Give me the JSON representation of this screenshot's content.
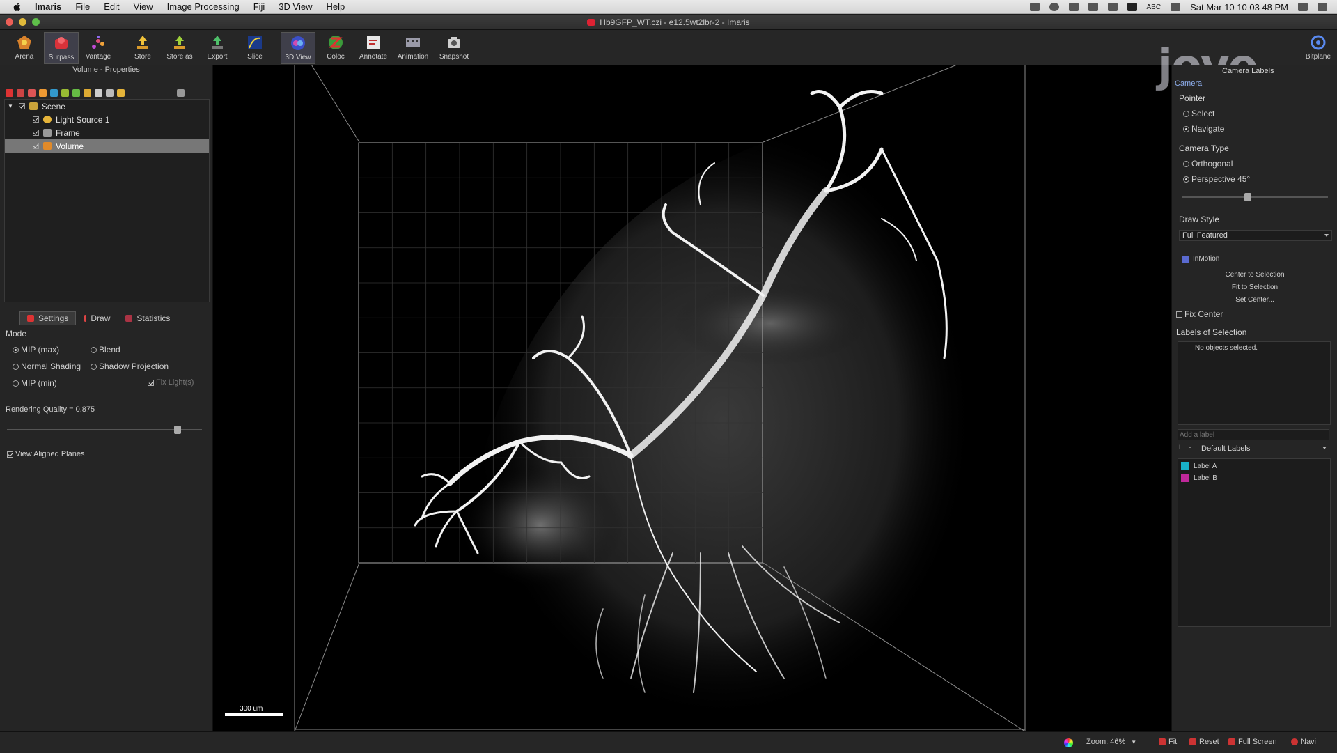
{
  "menubar": {
    "items": [
      "Imaris",
      "File",
      "Edit",
      "View",
      "Image Processing",
      "Fiji",
      "3D View",
      "Help"
    ],
    "input_indicator": "ABC",
    "clock": "Sat Mar 10  10 03 48 PM"
  },
  "window": {
    "title": "Hb9GFP_WT.czi - e12.5wt2lbr-2 - Imaris"
  },
  "toolbar": {
    "buttons": [
      "Arena",
      "Surpass",
      "Vantage",
      "Store",
      "Store as",
      "Export",
      "Slice",
      "3D View",
      "Coloc",
      "Annotate",
      "Animation",
      "Snapshot"
    ],
    "right_button": "Bitplane",
    "active": [
      "Surpass",
      "3D View"
    ]
  },
  "left_panel": {
    "title": "Volume - Properties",
    "tree": [
      {
        "label": "Scene",
        "checked": true,
        "selected": false
      },
      {
        "label": "Light Source 1",
        "checked": true,
        "selected": false
      },
      {
        "label": "Frame",
        "checked": true,
        "selected": false
      },
      {
        "label": "Volume",
        "checked": true,
        "selected": true
      }
    ],
    "tabs": [
      "Settings",
      "Draw",
      "Statistics"
    ],
    "mode_label": "Mode",
    "modes": [
      "MIP (max)",
      "Blend",
      "Normal Shading",
      "Shadow Projection",
      "MIP (min)"
    ],
    "selected_mode": "MIP (max)",
    "fix_lights": "Fix Light(s)",
    "rendering_quality_label": "Rendering Quality = 0.875",
    "rendering_quality": 0.875,
    "view_aligned_planes": "View Aligned Planes"
  },
  "viewer": {
    "scale_label": "300 um"
  },
  "right_panel": {
    "tabs": [
      "Camera",
      "Camera Labels"
    ],
    "pointer_label": "Pointer",
    "pointer_options": [
      "Select",
      "Navigate"
    ],
    "pointer_selected": "Navigate",
    "camera_type_label": "Camera Type",
    "camera_types": [
      "Orthogonal",
      "Perspective 45°"
    ],
    "camera_selected": "Perspective 45°",
    "perspective_value": 0.45,
    "draw_style_label": "Draw Style",
    "draw_style_value": "Full Featured",
    "inmotion": "InMotion",
    "actions": [
      "Center to Selection",
      "Fit to Selection",
      "Set Center..."
    ],
    "fix_center": "Fix Center",
    "labels_of_selection": "Labels of Selection",
    "no_objects": "No objects selected.",
    "add_label_placeholder": "Add a label",
    "label_set": "Default Labels",
    "labels": [
      {
        "name": "Label A",
        "color": "#18b0c8"
      },
      {
        "name": "Label B",
        "color": "#c0289a"
      }
    ]
  },
  "statusbar": {
    "zoom": "Zoom: 46%",
    "fit": "Fit",
    "reset": "Reset",
    "full_screen": "Full Screen",
    "navi": "Navi"
  },
  "watermark": "jove"
}
